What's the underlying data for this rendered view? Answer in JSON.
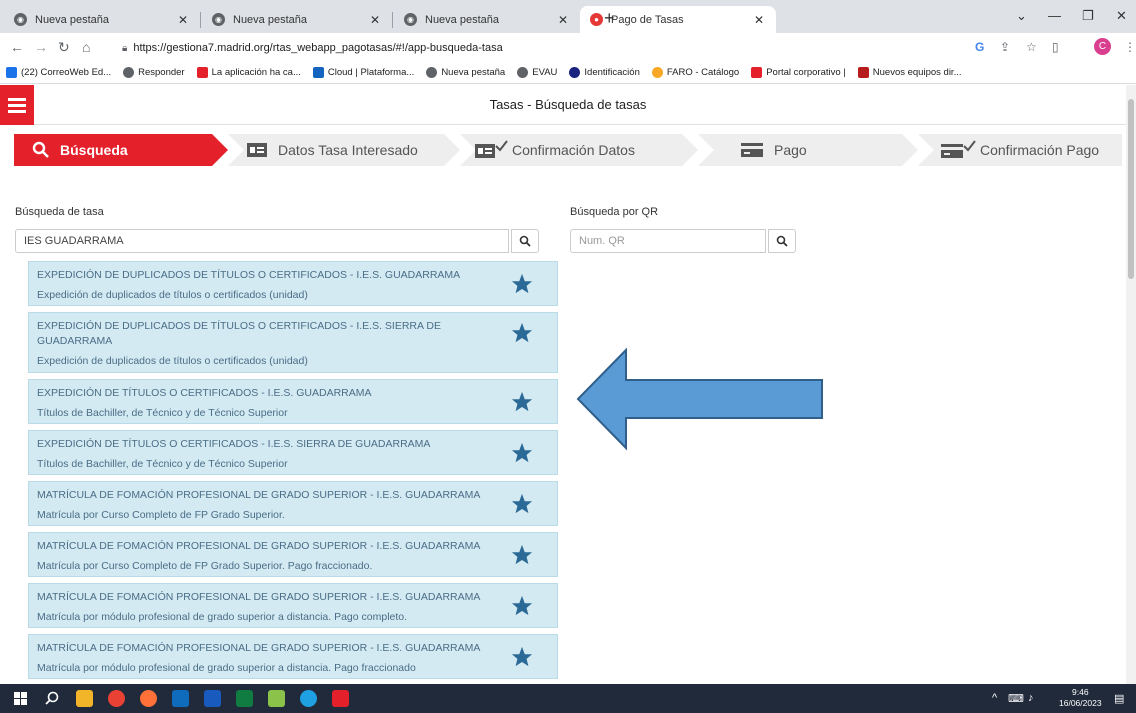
{
  "browser": {
    "tabs": [
      {
        "title": "Nueva pestaña",
        "active": false
      },
      {
        "title": "Nueva pestaña",
        "active": false
      },
      {
        "title": "Nueva pestaña",
        "active": false
      },
      {
        "title": "Pago de Tasas",
        "active": true
      }
    ],
    "url": "https://gestiona7.madrid.org/rtas_webapp_pagotasas/#!/app-busqueda-tasa",
    "profile_initial": "C",
    "bookmarks": [
      "(22) CorreoWeb Ed...",
      "Responder",
      "La aplicación ha ca...",
      "Cloud | Plataforma...",
      "Nueva pestaña",
      "EVAU",
      "Identificación",
      "FARO - Catálogo",
      "Portal corporativo |",
      "Nuevos equipos dir..."
    ]
  },
  "app": {
    "title": "Tasas - Búsqueda de tasas",
    "accent": "#e4202b",
    "steps": [
      {
        "label": "Búsqueda",
        "active": true,
        "icon": "search-icon"
      },
      {
        "label": "Datos Tasa Interesado",
        "active": false,
        "icon": "id-card-icon"
      },
      {
        "label": "Confirmación Datos",
        "active": false,
        "icon": "id-card-check-icon"
      },
      {
        "label": "Pago",
        "active": false,
        "icon": "card-icon"
      },
      {
        "label": "Confirmación Pago",
        "active": false,
        "icon": "card-check-icon"
      }
    ]
  },
  "search": {
    "label": "Búsqueda de tasa",
    "value": "IES GUADARRAMA",
    "qr_label": "Búsqueda por QR",
    "qr_placeholder": "Num. QR"
  },
  "results": [
    {
      "title": "EXPEDICIÓN DE DUPLICADOS DE TÍTULOS O CERTIFICADOS - I.E.S. GUADARRAMA",
      "desc": "Expedición de duplicados de títulos o certificados (unidad)"
    },
    {
      "title": "EXPEDICIÓN DE DUPLICADOS DE TÍTULOS O CERTIFICADOS - I.E.S. SIERRA DE GUADARRAMA",
      "desc": "Expedición de duplicados de títulos o certificados (unidad)"
    },
    {
      "title": "EXPEDICIÓN DE TÍTULOS O CERTIFICADOS - I.E.S. GUADARRAMA",
      "desc": "Títulos de Bachiller, de Técnico y de Técnico Superior"
    },
    {
      "title": "EXPEDICIÓN DE TÍTULOS O CERTIFICADOS - I.E.S. SIERRA DE GUADARRAMA",
      "desc": "Títulos de Bachiller, de Técnico y de Técnico Superior"
    },
    {
      "title": "MATRÍCULA DE FOMACIÓN PROFESIONAL DE GRADO SUPERIOR - I.E.S. GUADARRAMA",
      "desc": "Matrícula por Curso Completo de FP Grado Superior."
    },
    {
      "title": "MATRÍCULA DE FOMACIÓN PROFESIONAL DE GRADO SUPERIOR - I.E.S. GUADARRAMA",
      "desc": "Matrícula por Curso Completo de FP Grado Superior. Pago fraccionado."
    },
    {
      "title": "MATRÍCULA DE FOMACIÓN PROFESIONAL DE GRADO SUPERIOR - I.E.S. GUADARRAMA",
      "desc": "Matrícula por módulo profesional de grado superior a distancia. Pago completo."
    },
    {
      "title": "MATRÍCULA DE FOMACIÓN PROFESIONAL DE GRADO SUPERIOR - I.E.S. GUADARRAMA",
      "desc": "Matrícula por módulo profesional de grado superior a distancia. Pago fraccionado"
    }
  ],
  "taskbar": {
    "time": "9:46",
    "date": "16/06/2023"
  }
}
